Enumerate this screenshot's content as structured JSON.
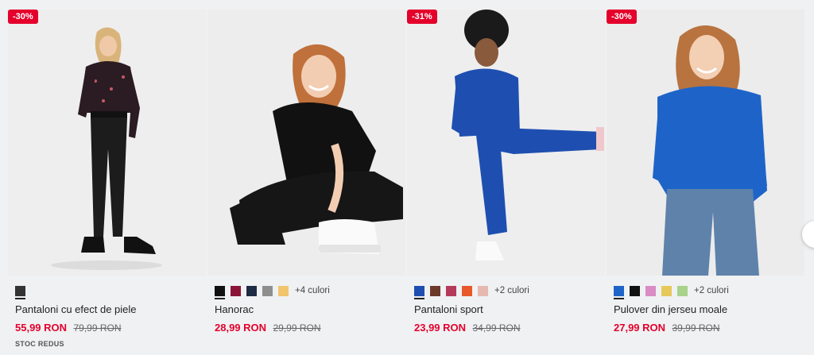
{
  "products": [
    {
      "badge": "-30%",
      "title": "Pantaloni cu efect de piele",
      "price": "55,99 RON",
      "old_price": "79,99 RON",
      "stock": "STOC REDUS",
      "swatches": [
        "#333333"
      ],
      "more_colors": ""
    },
    {
      "badge": "",
      "title": "Hanorac",
      "price": "28,99 RON",
      "old_price": "29,99 RON",
      "stock": "",
      "swatches": [
        "#111111",
        "#8a1538",
        "#1f2a44",
        "#8e8e8e",
        "#f2c46d"
      ],
      "more_colors": "+4 culori"
    },
    {
      "badge": "-31%",
      "title": "Pantaloni sport",
      "price": "23,99 RON",
      "old_price": "34,99 RON",
      "stock": "",
      "swatches": [
        "#1e4fb0",
        "#6b3a2a",
        "#b53a5a",
        "#e8582a",
        "#e6b9b0"
      ],
      "more_colors": "+2 culori"
    },
    {
      "badge": "-30%",
      "title": "Pulover din jerseu moale",
      "price": "27,99 RON",
      "old_price": "39,99 RON",
      "stock": "",
      "swatches": [
        "#1e64c8",
        "#111111",
        "#d98cc4",
        "#e7c95a",
        "#a9d28a"
      ],
      "more_colors": "+2 culori"
    }
  ],
  "icons": {
    "next": "chevron-right-icon"
  },
  "colors": {
    "sale": "#e4002b",
    "background": "#f0f1f3"
  }
}
